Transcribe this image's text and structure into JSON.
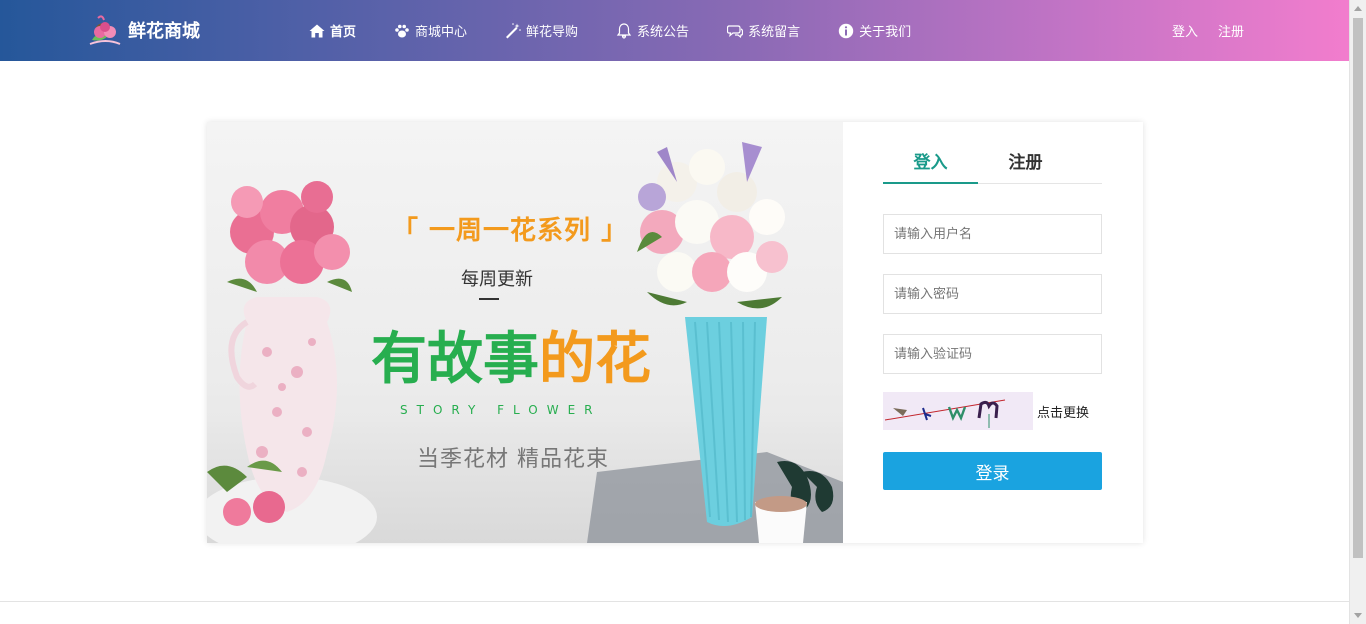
{
  "brand": {
    "name": "鲜花商城",
    "icon": "flower-logo-icon"
  },
  "nav": {
    "items": [
      {
        "label": "首页",
        "icon": "home-icon",
        "active": true
      },
      {
        "label": "商城中心",
        "icon": "paw-icon",
        "active": false
      },
      {
        "label": "鲜花导购",
        "icon": "magic-wand-icon",
        "active": false
      },
      {
        "label": "系统公告",
        "icon": "bell-icon",
        "active": false
      },
      {
        "label": "系统留言",
        "icon": "comments-icon",
        "active": false
      },
      {
        "label": "关于我们",
        "icon": "info-circle-icon",
        "active": false
      }
    ],
    "login": "登入",
    "register": "注册"
  },
  "banner": {
    "series": "「 一周一花系列 」",
    "weekly": "每周更新",
    "title_green": "有故事",
    "title_orange": "的花",
    "english": "STORY FLOWER",
    "tagline": "当季花材  精品花束"
  },
  "login_form": {
    "tabs": [
      "登入",
      "注册"
    ],
    "active_tab": "登入",
    "username_placeholder": "请输入用户名",
    "password_placeholder": "请输入密码",
    "captcha_placeholder": "请输入验证码",
    "captcha_refresh": "点击更换",
    "submit": "登录"
  },
  "colors": {
    "header_gradient_start": "#25579a",
    "header_gradient_end": "#f27dcd",
    "tab_active": "#1a9a8a",
    "submit_button": "#1aa3e0",
    "banner_green": "#27ae4f",
    "banner_orange": "#f39a1d"
  }
}
